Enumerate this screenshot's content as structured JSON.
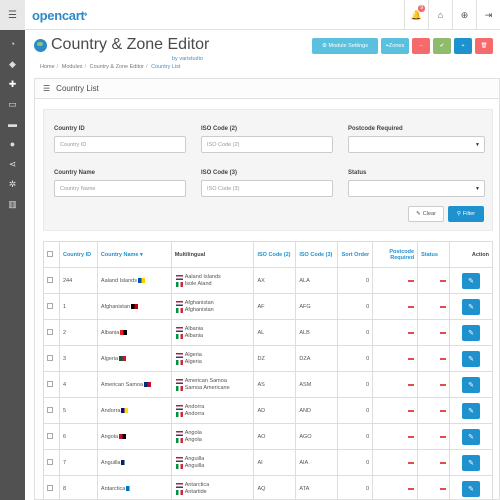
{
  "header": {
    "logo": "opencart",
    "notification_count": "9"
  },
  "page": {
    "title": "Country & Zone Editor",
    "byline": "by varistudio",
    "breadcrumb": [
      "Home",
      "Modules",
      "Country & Zone Editor",
      "Country List"
    ],
    "actions": {
      "module_settings": "Module Settings",
      "zones": "Zones"
    }
  },
  "panel": {
    "title": "Country List"
  },
  "filter": {
    "country_id_label": "Country ID",
    "country_id_placeholder": "Country ID",
    "iso2_label": "ISO Code (2)",
    "iso2_placeholder": "ISO Code (2)",
    "postcode_label": "Postcode Required",
    "country_name_label": "Country Name",
    "country_name_placeholder": "Country Name",
    "iso3_label": "ISO Code (3)",
    "iso3_placeholder": "ISO Code (3)",
    "status_label": "Status",
    "clear": "Clear",
    "filter": "Filter"
  },
  "table": {
    "headers": {
      "country_id": "Country ID",
      "country_name": "Country Name",
      "multilingual": "Multilingual",
      "iso2": "ISO Code (2)",
      "iso3": "ISO Code (3)",
      "sort_order": "Sort Order",
      "postcode": "Postcode Required",
      "status": "Status",
      "action": "Action"
    },
    "rows": [
      {
        "id": "244",
        "name": "Aaland Islands",
        "ml1": "Aaland Islands",
        "ml2": "Isole Aland",
        "iso2": "AX",
        "iso3": "ALA",
        "sort": "0"
      },
      {
        "id": "1",
        "name": "Afghanistan",
        "ml1": "Afghanistan",
        "ml2": "Afghanistan",
        "iso2": "AF",
        "iso3": "AFG",
        "sort": "0"
      },
      {
        "id": "2",
        "name": "Albania",
        "ml1": "Albania",
        "ml2": "Albania",
        "iso2": "AL",
        "iso3": "ALB",
        "sort": "0"
      },
      {
        "id": "3",
        "name": "Algeria",
        "ml1": "Algeria",
        "ml2": "Algeria",
        "iso2": "DZ",
        "iso3": "DZA",
        "sort": "0"
      },
      {
        "id": "4",
        "name": "American Samoa",
        "ml1": "American Samoa",
        "ml2": "Samoa Americane",
        "iso2": "AS",
        "iso3": "ASM",
        "sort": "0"
      },
      {
        "id": "5",
        "name": "Andorra",
        "ml1": "Andorra",
        "ml2": "Andorra",
        "iso2": "AD",
        "iso3": "AND",
        "sort": "0"
      },
      {
        "id": "6",
        "name": "Angola",
        "ml1": "Angola",
        "ml2": "Angola",
        "iso2": "AO",
        "iso3": "AGO",
        "sort": "0"
      },
      {
        "id": "7",
        "name": "Anguilla",
        "ml1": "Anguilla",
        "ml2": "Anguilla",
        "iso2": "AI",
        "iso3": "AIA",
        "sort": "0"
      },
      {
        "id": "8",
        "name": "Antarctica",
        "ml1": "Antarctica",
        "ml2": "Antartide",
        "iso2": "AQ",
        "iso3": "ATA",
        "sort": "0"
      }
    ]
  },
  "colors": {
    "primary": "#1e91cf",
    "danger": "#f56b6b",
    "success": "#8fbb6c",
    "info": "#5bc0de",
    "sidebar": "#515151"
  }
}
